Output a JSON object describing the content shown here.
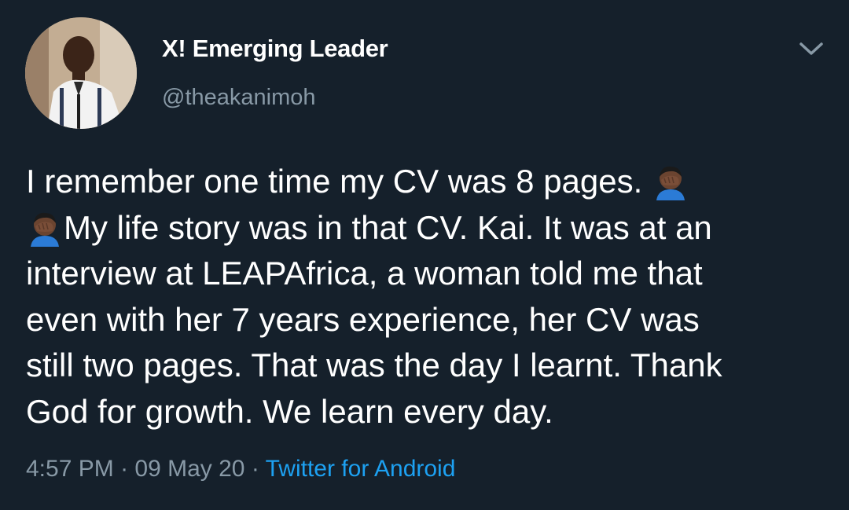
{
  "tweet": {
    "display_name": "X! Emerging Leader",
    "handle": "@theakanimoh",
    "text_lines": [
      "I remember one time my CV was 8 pages. ",
      "My life story was in that CV. Kai. It was at an",
      "interview at LEAPAfrica, a woman told me that",
      "even with her 7 years experience, her CV was",
      "still two pages. That was the day I learnt. Thank",
      "God for growth. We learn every day."
    ],
    "emoji_icon": "face-palm-emoji",
    "time": "4:57 PM",
    "separator": " · ",
    "date": "09 May 20",
    "source": "Twitter for Android"
  },
  "colors": {
    "background": "#15202b",
    "text": "#ffffff",
    "secondary": "#8899a6",
    "link": "#1da1f2"
  }
}
